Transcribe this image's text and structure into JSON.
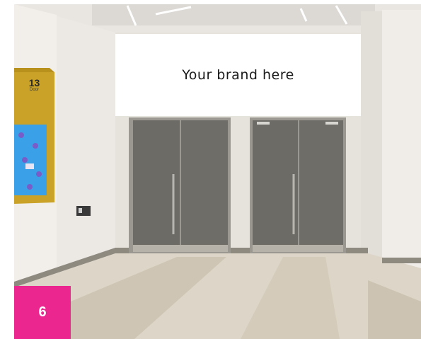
{
  "banner": {
    "text": "Your brand here"
  },
  "badge": {
    "number": "6",
    "color": "#ec268f"
  },
  "wall_sign": {
    "number": "13",
    "sublabel": "Door"
  },
  "colors": {
    "wall": "#ebe8e4",
    "door": "#6c6b66",
    "floor_light": "#ddd5c7",
    "floor_dark": "#cfc5b4",
    "sign_gold": "#c9a227",
    "screen_blue": "#3aa0e8"
  }
}
